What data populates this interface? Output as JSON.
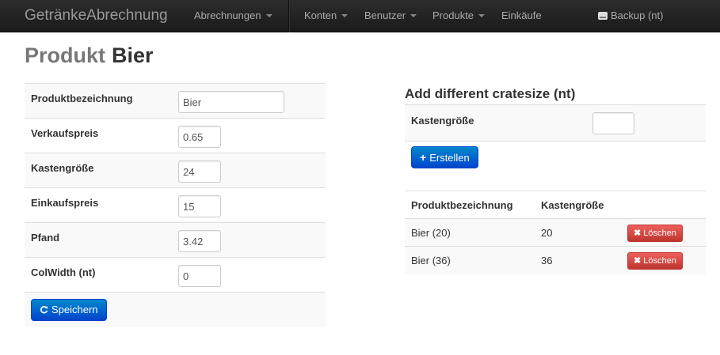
{
  "navbar": {
    "brand": "GetränkeAbrechnung",
    "items": [
      {
        "label": "Abrechnungen",
        "dropdown": true
      },
      {
        "label": "Konten",
        "dropdown": true
      },
      {
        "label": "Benutzer",
        "dropdown": true
      },
      {
        "label": "Produkte",
        "dropdown": true
      },
      {
        "label": "Einkäufe",
        "dropdown": false
      }
    ],
    "backup": {
      "label": "Backup (nt)",
      "icon": "hdd-icon"
    }
  },
  "header": {
    "prefix": "Produkt",
    "name": "Bier"
  },
  "form": {
    "fields": [
      {
        "label": "Produktbezeichnung",
        "value": "Bier"
      },
      {
        "label": "Verkaufspreis",
        "value": "0.65"
      },
      {
        "label": "Kastengröße",
        "value": "24"
      },
      {
        "label": "Einkaufspreis",
        "value": "15"
      },
      {
        "label": "Pfand",
        "value": "3.42"
      },
      {
        "label": "ColWidth (nt)",
        "value": "0"
      }
    ],
    "save": {
      "label": "Speichern",
      "icon": "refresh-icon"
    }
  },
  "cratesize": {
    "title": "Add different cratesize (nt)",
    "field_label": "Kastengröße",
    "field_value": "",
    "create": {
      "label": "Erstellen",
      "icon": "plus-icon"
    },
    "table": {
      "headers": [
        "Produktbezeichnung",
        "Kastengröße",
        ""
      ],
      "rows": [
        {
          "name": "Bier (20)",
          "size": "20",
          "action": "Löschen"
        },
        {
          "name": "Bier (36)",
          "size": "36",
          "action": "Löschen"
        }
      ]
    }
  },
  "colors": {
    "primary": "#0088cc",
    "danger": "#da4f49",
    "navbar": "#222222"
  }
}
